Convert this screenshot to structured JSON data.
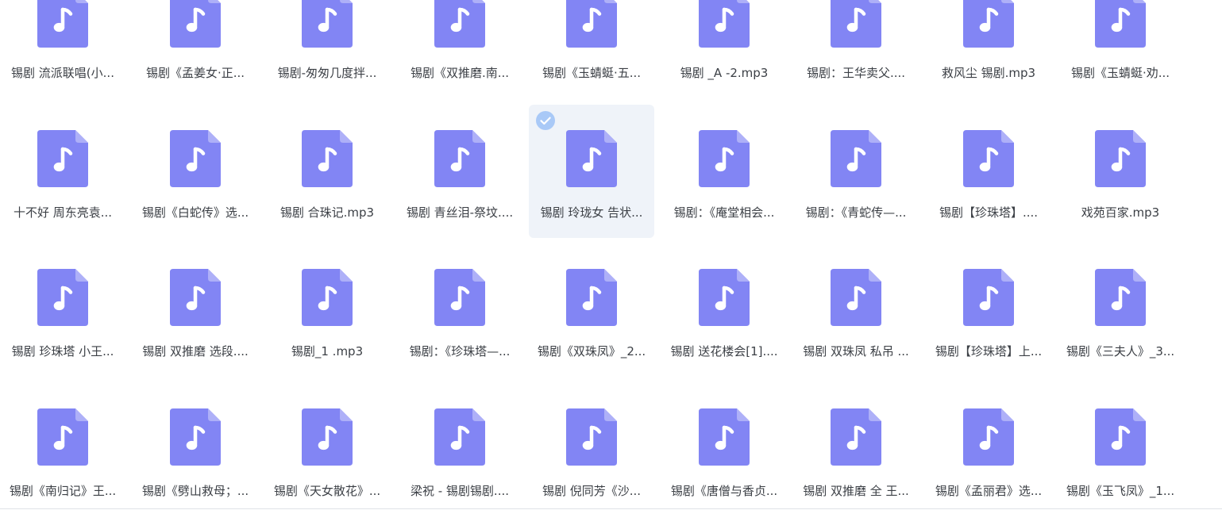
{
  "colors": {
    "icon_fill": "#8285f4",
    "icon_fold": "#aeb0f8",
    "selected_bg": "#eff3f9",
    "check_fill": "#a9c9f7",
    "text": "#3b3f45"
  },
  "icons": {
    "file": "music-file-icon",
    "selected": "checkmark-icon"
  },
  "files": [
    {
      "name": "锡剧 流派联唱(小...",
      "selected": false
    },
    {
      "name": "锡剧《孟姜女·正...",
      "selected": false
    },
    {
      "name": "锡剧-匆匆几度拌...",
      "selected": false
    },
    {
      "name": "锡剧《双推磨.南...",
      "selected": false
    },
    {
      "name": "锡剧《玉蜻蜓·五...",
      "selected": false
    },
    {
      "name": "锡剧 _A -2.mp3",
      "selected": false
    },
    {
      "name": "锡剧：王华卖父....",
      "selected": false
    },
    {
      "name": "救风尘 锡剧.mp3",
      "selected": false
    },
    {
      "name": "锡剧《玉蜻蜓·劝...",
      "selected": false
    },
    {
      "name": "十不好 周东亮袁...",
      "selected": false
    },
    {
      "name": "锡剧《白蛇传》选...",
      "selected": false
    },
    {
      "name": "锡剧 合珠记.mp3",
      "selected": false
    },
    {
      "name": "锡剧 青丝泪-祭坟....",
      "selected": false
    },
    {
      "name": "锡剧 玲珑女 告状...",
      "selected": true
    },
    {
      "name": "锡剧：《庵堂相会...",
      "selected": false
    },
    {
      "name": "锡剧：《青蛇传—...",
      "selected": false
    },
    {
      "name": "锡剧【珍珠塔】....",
      "selected": false
    },
    {
      "name": "戏苑百家.mp3",
      "selected": false
    },
    {
      "name": "锡剧 珍珠塔 小王...",
      "selected": false
    },
    {
      "name": "锡剧 双推磨 选段....",
      "selected": false
    },
    {
      "name": "锡剧_1 .mp3",
      "selected": false
    },
    {
      "name": "锡剧：《珍珠塔—...",
      "selected": false
    },
    {
      "name": "锡剧《双珠凤》_2...",
      "selected": false
    },
    {
      "name": "锡剧 送花楼会[1]....",
      "selected": false
    },
    {
      "name": "锡剧 双珠凤 私吊 ...",
      "selected": false
    },
    {
      "name": "锡剧【珍珠塔】上...",
      "selected": false
    },
    {
      "name": "锡剧《三夫人》_3...",
      "selected": false
    },
    {
      "name": "锡剧《南归记》王...",
      "selected": false
    },
    {
      "name": "锡剧《劈山救母；...",
      "selected": false
    },
    {
      "name": "锡剧《天女散花》...",
      "selected": false
    },
    {
      "name": "梁祝 - 锡剧锡剧....",
      "selected": false
    },
    {
      "name": "锡剧 倪同芳《沙...",
      "selected": false
    },
    {
      "name": "锡剧《唐僧与香贞...",
      "selected": false
    },
    {
      "name": "锡剧 双推磨 全 王...",
      "selected": false
    },
    {
      "name": "锡剧《孟丽君》选...",
      "selected": false
    },
    {
      "name": "锡剧《玉飞凤》_1...",
      "selected": false
    }
  ]
}
